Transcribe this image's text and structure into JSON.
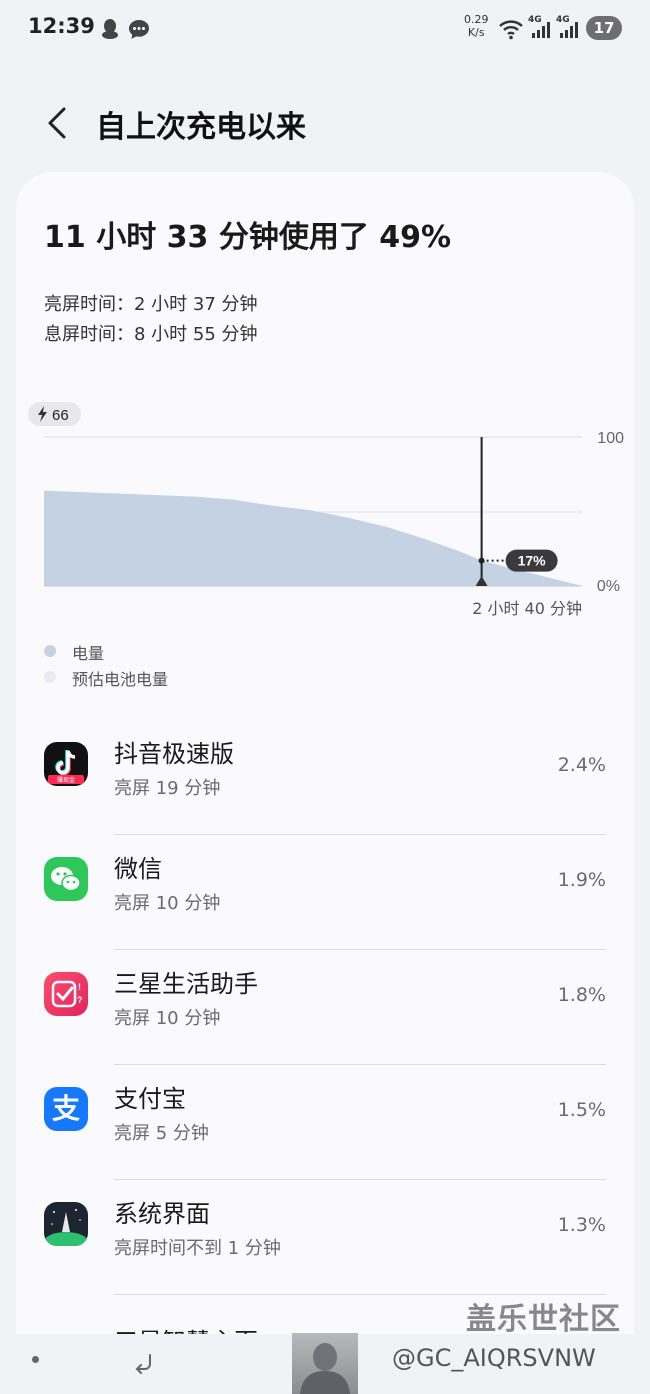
{
  "status_bar": {
    "time": "12:39",
    "net_speed_value": "0.29",
    "net_speed_unit": "K/s",
    "signal1": "4G",
    "signal2": "4G",
    "battery": "17"
  },
  "header": {
    "title": "自上次充电以来"
  },
  "summary": {
    "headline": "11 小时 33 分钟使用了 49%",
    "screen_on": "亮屏时间：2 小时 37 分钟",
    "screen_off": "息屏时间：8 小时 55 分钟"
  },
  "chart_data": {
    "type": "area",
    "charge_badge": "66",
    "y_max_label": "100",
    "y_min_label": "0%",
    "ylim": [
      0,
      100
    ],
    "current_label": "17%",
    "x_marker_label": "2 小时 40 分钟",
    "series": [
      {
        "name": "电量",
        "color": "#c5d2e3",
        "x_hours": [
          0,
          1,
          2,
          3,
          4,
          5,
          6,
          7,
          8,
          9,
          10,
          11,
          11.55,
          14.2
        ],
        "y": [
          64,
          63,
          62,
          61,
          60,
          58,
          54,
          51,
          46,
          40,
          32,
          23,
          17,
          0
        ]
      }
    ]
  },
  "legend": [
    {
      "label": "电量",
      "color": "#c5d2e3"
    },
    {
      "label": "预估电池电量",
      "color": "#e7ebf2"
    }
  ],
  "apps": [
    {
      "name": "抖音极速版",
      "sub": "亮屏 19 分钟",
      "pct": "2.4%",
      "icon": "douyin-lite-icon",
      "badge": "赚现金"
    },
    {
      "name": "微信",
      "sub": "亮屏 10 分钟",
      "pct": "1.9%",
      "icon": "wechat-icon"
    },
    {
      "name": "三星生活助手",
      "sub": "亮屏 10 分钟",
      "pct": "1.8%",
      "icon": "samsung-life-assistant-icon"
    },
    {
      "name": "支付宝",
      "sub": "亮屏 5 分钟",
      "pct": "1.5%",
      "icon": "alipay-icon",
      "glyph": "支"
    },
    {
      "name": "系统界面",
      "sub": "亮屏时间不到 1 分钟",
      "pct": "1.3%",
      "icon": "system-ui-icon"
    }
  ],
  "partial_app": "三星智慧主页",
  "watermark": "盖乐世社区",
  "credit": "@GC_AIQRSVNW"
}
